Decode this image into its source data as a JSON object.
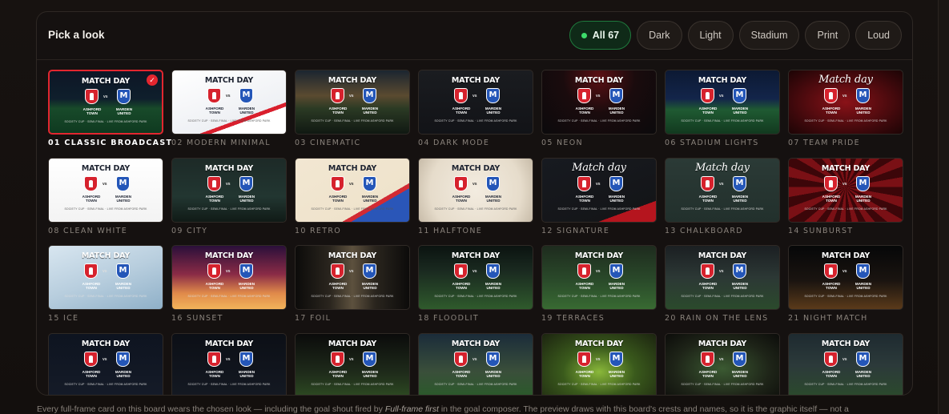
{
  "panel": {
    "title": "Pick a look"
  },
  "filters": [
    {
      "label": "All 67",
      "active": true
    },
    {
      "label": "Dark",
      "active": false
    },
    {
      "label": "Light",
      "active": false
    },
    {
      "label": "Stadium",
      "active": false
    },
    {
      "label": "Print",
      "active": false
    },
    {
      "label": "Loud",
      "active": false
    }
  ],
  "thumb_text": {
    "title": "MATCH DAY",
    "title_script": "Match day",
    "vs": "vs",
    "home": "ASHFORD TOWN",
    "away": "MARDEN UNITED",
    "meta1": "SOCIETY CUP · SEMI-FINAL",
    "meta2": "LIVE FROM ASHFORD PARK"
  },
  "looks": [
    {
      "label": "01 CLASSIC BROADCAST",
      "selected": true,
      "bg": "linear-gradient(180deg,#0d1626 0%,#0f1f2c 45%,#184a2a 60%,#0f3a20 100%)"
    },
    {
      "label": "02 MODERN MINIMAL",
      "bg": "linear-gradient(160deg,#ffffff 0%,#eef0f4 70%,#d91f2d 70%,#d91f2d 74%,#ffffff 74%)",
      "dark_text": true
    },
    {
      "label": "03 CINEMATIC",
      "bg": "linear-gradient(180deg,#1b2530 0%,#5a4a30 40%,#2b3a24 60%,#101812 100%)"
    },
    {
      "label": "04 DARK MODE",
      "bg": "linear-gradient(180deg,#1a1c20 0%,#121317 100%)"
    },
    {
      "label": "05 NEON",
      "bg": "radial-gradient(ellipse at 50% 10%,#5b1014 0%,#1a0b0d 45%,#0b0a0c 100%)"
    },
    {
      "label": "06 STADIUM LIGHTS",
      "bg": "linear-gradient(180deg,#0c1933 0%,#13254a 45%,#1f5a32 62%,#12391f 100%)"
    },
    {
      "label": "07 TEAM PRIDE",
      "bg": "radial-gradient(ellipse at 50% 50%,#8a1218 0%,#3b080b 70%,#1c0405 100%)",
      "script": true
    },
    {
      "label": "08 CLEAN WHITE",
      "bg": "linear-gradient(180deg,#ffffff 0%,#f3f3f3 100%)",
      "dark_text": true
    },
    {
      "label": "09 CITY",
      "bg": "linear-gradient(180deg,#1d2a27 0%,#223631 60%,#101a16 100%)"
    },
    {
      "label": "10 RETRO",
      "bg": "linear-gradient(150deg,#f2e7d2 0%,#efe3cc 70%,#d22a33 70%,#d22a33 74%,#2a56b8 74%)",
      "dark_text": true
    },
    {
      "label": "11 HALFTONE",
      "bg": "radial-gradient(circle at 50% 50%,#f3ece0 0%,#e6dccb 70%,#c7bba8 100%)",
      "dark_text": true
    },
    {
      "label": "12 SIGNATURE",
      "bg": "linear-gradient(160deg,#171a20 0%,#141518 80%,#b5151e 80%)",
      "script": true
    },
    {
      "label": "13 CHALKBOARD",
      "bg": "linear-gradient(180deg,#2b3a36 0%,#22302c 100%)",
      "script": true
    },
    {
      "label": "14 SUNBURST",
      "bg": "repeating-conic-gradient(from 0deg at 50% 45%,#7a1015 0deg 10deg,#3c0609 10deg 20deg)"
    },
    {
      "label": "15 ICE",
      "bg": "linear-gradient(160deg,#d8e6f0 0%,#b8cede 50%,#8fb0c8 100%)"
    },
    {
      "label": "16 SUNSET",
      "bg": "linear-gradient(180deg,#2a0f3a 0%,#8a2b46 45%,#e08a4a 75%,#f2b35a 100%)"
    },
    {
      "label": "17 FOIL",
      "bg": "linear-gradient(90deg,#0c0b0a 0%,#2a251e 30%,#5d513e 50%,#2a251e 70%,#0c0b0a 100%)"
    },
    {
      "label": "18 FLOODLIT",
      "bg": "linear-gradient(180deg,#0b1310 0%,#1a2a20 40%,#2f5a2c 100%)"
    },
    {
      "label": "19 TERRACES",
      "bg": "linear-gradient(180deg,#1e2b1e 0%,#2a4a2a 55%,#386a32 100%)"
    },
    {
      "label": "20 RAIN ON THE LENS",
      "bg": "linear-gradient(180deg,#1b1f22 0%,#2c3835 50%,#2b4a2c 100%)"
    },
    {
      "label": "21 NIGHT MATCH",
      "bg": "linear-gradient(180deg,#060708 0%,#1a1410 55%,#5a3a1a 100%)"
    },
    {
      "label": "",
      "bg": "linear-gradient(180deg,#0e1420 0%,#151b28 100%)"
    },
    {
      "label": "",
      "bg": "linear-gradient(180deg,#0c0f16 0%,#141922 100%)"
    },
    {
      "label": "",
      "bg": "linear-gradient(180deg,#0b0b0b 0%,#1e2a1a 60%,#2d4a22 100%)"
    },
    {
      "label": "",
      "bg": "linear-gradient(180deg,#1b2c3a 0%,#3a4f3a 60%,#2a5a2a 100%)"
    },
    {
      "label": "",
      "bg": "radial-gradient(ellipse at 50% 60%,#8ab83a 0%,#3a5a1c 45%,#1c2410 100%)"
    },
    {
      "label": "",
      "bg": "radial-gradient(ellipse at 50% 55%,#3b5a32 0%,#1e2418 60%,#0c0c0a 100%)"
    },
    {
      "label": "",
      "bg": "linear-gradient(180deg,#1e2a30 0%,#2c3a3a 50%,#2b4a2c 100%)"
    }
  ],
  "footer": {
    "before": "Every full-frame card on this board wears the chosen look — including the goal shout fired by ",
    "emph": "Full-frame first",
    "after": " in the goal composer. The preview draws with this board's crests and names, so it is the graphic itself — not a"
  }
}
